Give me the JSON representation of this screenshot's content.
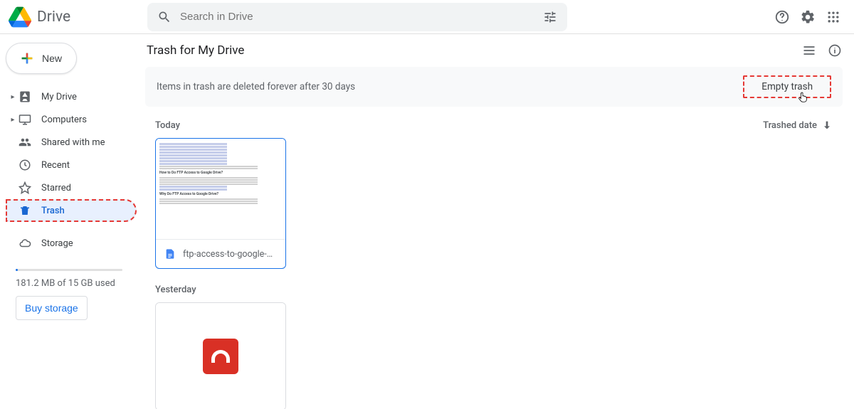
{
  "header": {
    "product_name": "Drive",
    "search_placeholder": "Search in Drive"
  },
  "sidebar": {
    "new_label": "New",
    "items": [
      {
        "icon": "drive",
        "label": "My Drive",
        "expandable": true
      },
      {
        "icon": "computers",
        "label": "Computers",
        "expandable": true
      },
      {
        "icon": "shared",
        "label": "Shared with me",
        "expandable": false
      },
      {
        "icon": "recent",
        "label": "Recent",
        "expandable": false
      },
      {
        "icon": "starred",
        "label": "Starred",
        "expandable": false
      },
      {
        "icon": "trash",
        "label": "Trash",
        "expandable": false,
        "selected": true,
        "highlighted": true
      },
      {
        "icon": "storage",
        "label": "Storage",
        "expandable": false,
        "spacer_before": true
      }
    ],
    "storage_text": "181.2 MB of 15 GB used",
    "buy_label": "Buy storage"
  },
  "main": {
    "title": "Trash for My Drive",
    "banner_text": "Items in trash are deleted forever after 30 days",
    "empty_trash_label": "Empty trash",
    "sort_label": "Trashed date",
    "groups": [
      {
        "heading": "Today",
        "files": [
          {
            "name": "ftp-access-to-google-driv…",
            "type": "doc",
            "selected": true
          }
        ]
      },
      {
        "heading": "Yesterday",
        "files": [
          {
            "name": "",
            "type": "app-red"
          }
        ]
      }
    ]
  }
}
